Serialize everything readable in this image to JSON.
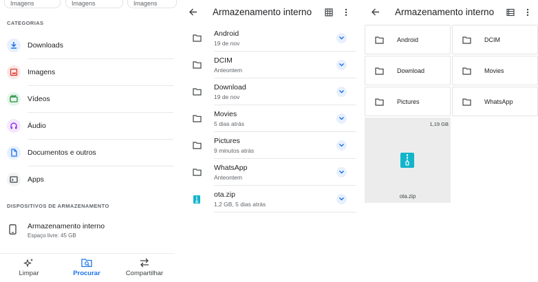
{
  "panel1": {
    "chips": [
      "Imagens",
      "Imagens",
      "Imagens"
    ],
    "categories_header": "CATEGORIAS",
    "categories": [
      {
        "label": "Downloads",
        "icon": "download-icon",
        "color": "#1a73e8",
        "bg": "#e8f0fe"
      },
      {
        "label": "Imagens",
        "icon": "image-icon",
        "color": "#d93025",
        "bg": "#fce8e6"
      },
      {
        "label": "Vídeos",
        "icon": "video-icon",
        "color": "#1e8e3e",
        "bg": "#e6f4ea"
      },
      {
        "label": "Áudio",
        "icon": "headphones-icon",
        "color": "#9334e6",
        "bg": "#f3e8fd"
      },
      {
        "label": "Documentos e outros",
        "icon": "document-icon",
        "color": "#1a73e8",
        "bg": "#e8f0fe"
      },
      {
        "label": "Apps",
        "icon": "apps-icon",
        "color": "#3c4043",
        "bg": "#f1f3f4"
      }
    ],
    "storage_header": "DISPOSITIVOS DE ARMAZENAMENTO",
    "storage": {
      "title": "Armazenamento interno",
      "subtitle": "Espaço livre: 45 GB"
    },
    "nav": [
      {
        "label": "Limpar",
        "icon": "sparkle-icon",
        "active": false
      },
      {
        "label": "Procurar",
        "icon": "browse-icon",
        "active": true
      },
      {
        "label": "Compartilhar",
        "icon": "swap-icon",
        "active": false
      }
    ]
  },
  "panel2": {
    "title": "Armazenamento interno",
    "items": [
      {
        "name": "Android",
        "meta": "19 de nov",
        "type": "folder"
      },
      {
        "name": "DCIM",
        "meta": "Anteontem",
        "type": "folder"
      },
      {
        "name": "Download",
        "meta": "19 de nov",
        "type": "folder"
      },
      {
        "name": "Movies",
        "meta": "5 dias atrás",
        "type": "folder"
      },
      {
        "name": "Pictures",
        "meta": "9 minutos atrás",
        "type": "folder"
      },
      {
        "name": "WhatsApp",
        "meta": "Anteontem",
        "type": "folder"
      },
      {
        "name": "ota.zip",
        "meta": "1,2 GB, 5 dias atrás",
        "type": "zip"
      }
    ]
  },
  "panel3": {
    "title": "Armazenamento interno",
    "folders": [
      "Android",
      "DCIM",
      "Download",
      "Movies",
      "Pictures",
      "WhatsApp"
    ],
    "zip": {
      "name": "ota.zip",
      "size": "1,19 GB"
    }
  },
  "colors": {
    "accent": "#1a73e8",
    "zip": "#12b5cb",
    "chevron_bg": "#e8f0fe"
  }
}
